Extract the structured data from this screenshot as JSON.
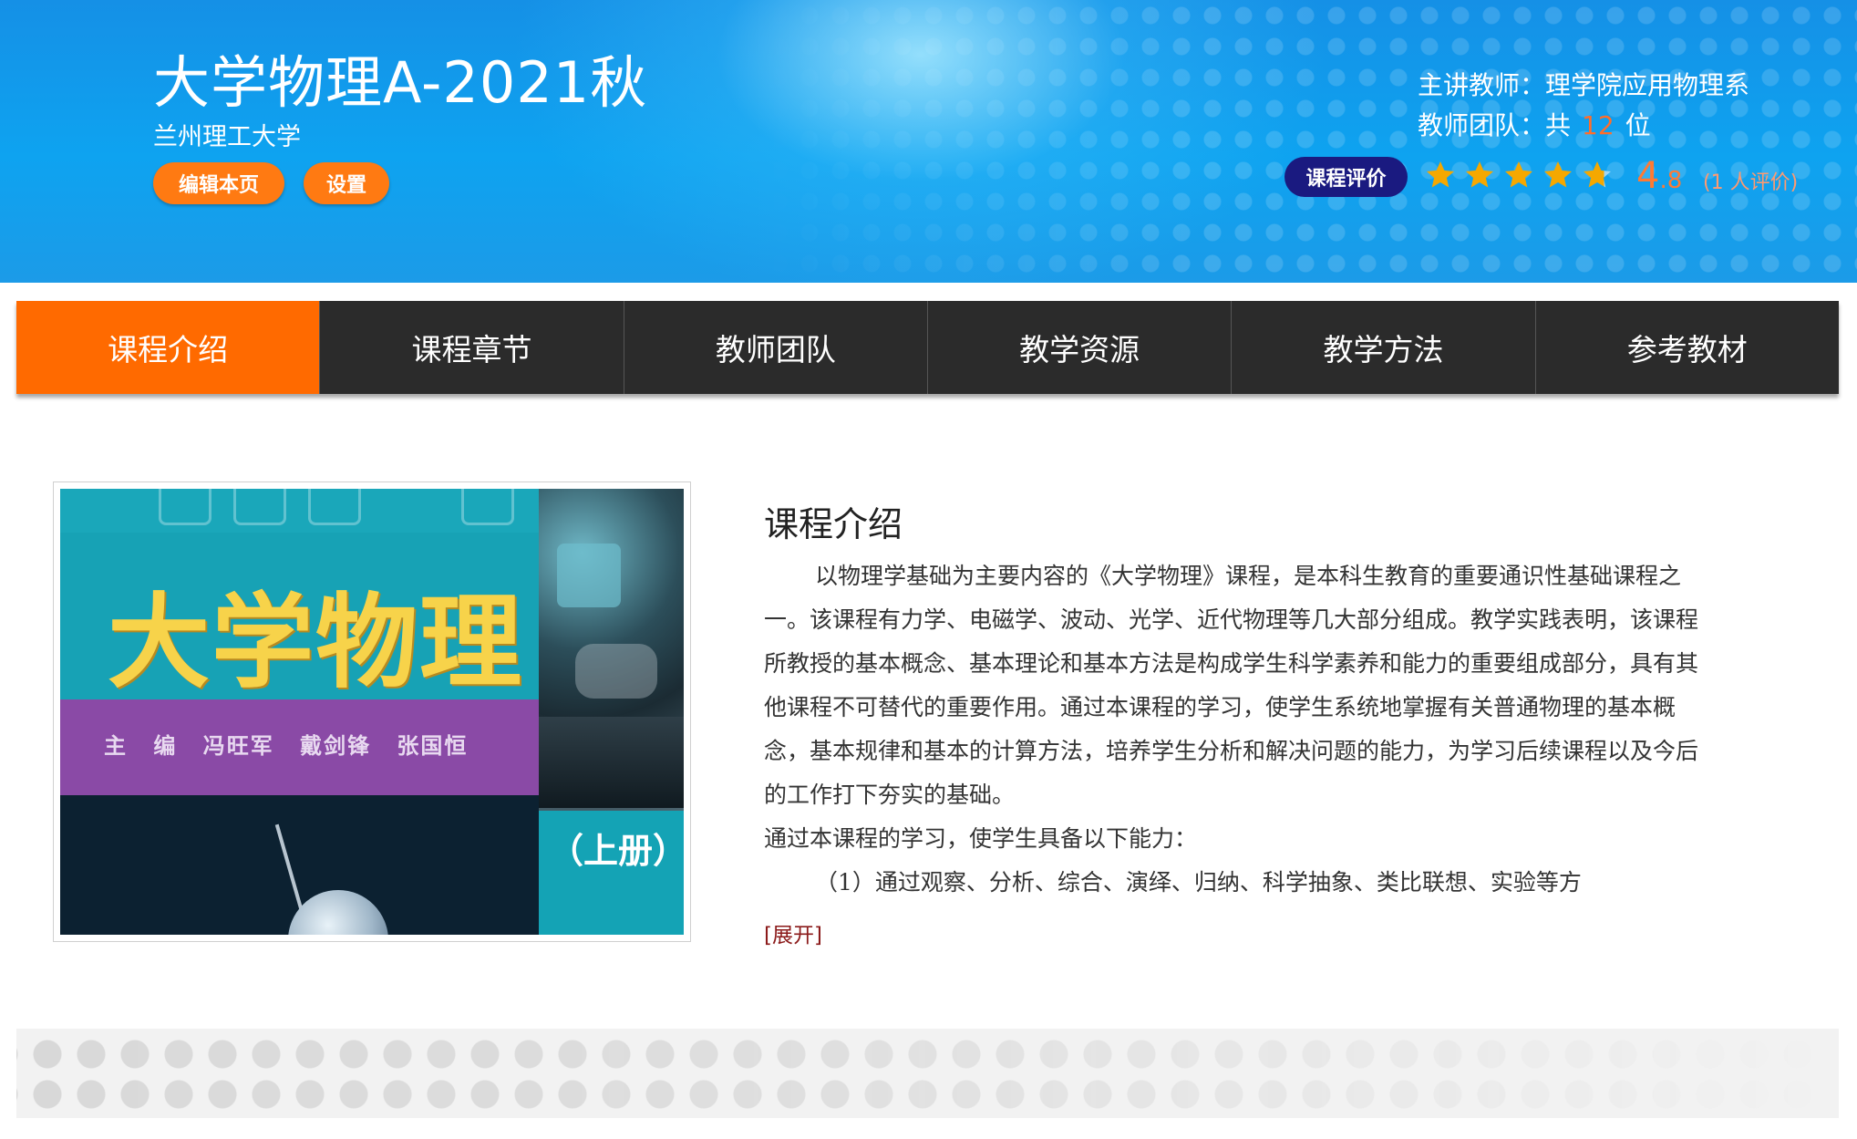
{
  "header": {
    "course_title": "大学物理A-2021秋",
    "school": "兰州理工大学",
    "edit_label": "编辑本页",
    "settings_label": "设置",
    "teacher_prefix": "主讲教师：",
    "teacher_name": "理学院应用物理系",
    "team_prefix": "教师团队：共",
    "team_count": "12",
    "team_suffix": "位",
    "rating_label": "课程评价",
    "rating_stars": 4.8,
    "score_int": "4",
    "score_dec": ".8",
    "raters": "(1 人评价)"
  },
  "nav": {
    "items": [
      {
        "label": "课程介绍",
        "active": true
      },
      {
        "label": "课程章节"
      },
      {
        "label": "教师团队"
      },
      {
        "label": "教学资源"
      },
      {
        "label": "教学方法"
      },
      {
        "label": "参考教材"
      }
    ]
  },
  "cover": {
    "title": "大学物理",
    "editors": "主 编 冯旺军 戴剑锋 张国恒",
    "volume": "（上册）"
  },
  "intro": {
    "heading": "课程介绍",
    "para1": "以物理学基础为主要内容的《大学物理》课程，是本科生教育的重要通识性基础课程之一。该课程有力学、电磁学、波动、光学、近代物理等几大部分组成。教学实践表明，该课程所教授的基本概念、基本理论和基本方法是构成学生科学素养和能力的重要组成部分，具有其他课程不可替代的重要作用。通过本课程的学习，使学生系统地掌握有关普通物理的基本概念，基本规律和基本的计算方法，培养学生分析和解决问题的能力，为学习后续课程以及今后的工作打下夯实的基础。",
    "para2": "通过本课程的学习，使学生具备以下能力：",
    "para3": "（1）通过观察、分析、综合、演绎、归纳、科学抽象、类比联想、实验等方",
    "expand_label": "[展开]"
  },
  "colors": {
    "accent_orange": "#ff6a00",
    "nav_dark": "#2b2b2b",
    "rating_navy": "#1a1a80",
    "score_orange": "#ff7a33",
    "star_gold": "#f5a800"
  }
}
